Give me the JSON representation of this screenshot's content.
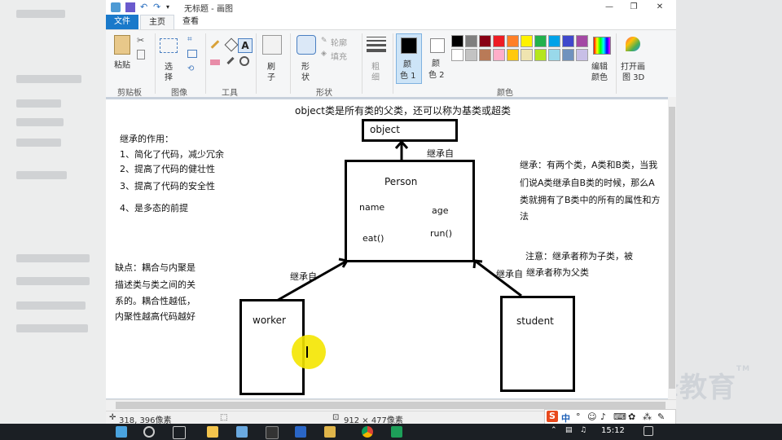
{
  "window": {
    "title": "无标题 - 画图",
    "minimize": "—",
    "restore": "❐",
    "close": "✕"
  },
  "tabs": {
    "file": "文件",
    "home": "主页",
    "view": "查看"
  },
  "ribbon": {
    "clipboard": {
      "paste": "粘贴",
      "label": "剪贴板"
    },
    "image": {
      "select": "选",
      "select2": "择",
      "label": "图像"
    },
    "tools": {
      "label": "工具"
    },
    "brushes": {
      "brush": "刷",
      "brush2": "子"
    },
    "shapes": {
      "shape": "形",
      "shape2": "状",
      "outline": "轮廓",
      "fill": "填充",
      "label": "形状"
    },
    "size": {
      "label": "粗",
      "label2": "细"
    },
    "colors": {
      "color1a": "颜",
      "color1b": "色 1",
      "color2a": "颜",
      "color2b": "色 2",
      "edit1": "编辑",
      "edit2": "颜色",
      "label": "颜色",
      "open3d_1": "打开画",
      "open3d_2": "图 3D"
    },
    "palette": [
      "#000000",
      "#7f7f7f",
      "#880015",
      "#ed1c24",
      "#ff7f27",
      "#fff200",
      "#22b14c",
      "#00a2e8",
      "#3f48cc",
      "#a349a4",
      "#ffffff",
      "#c3c3c3",
      "#b97a57",
      "#ffaec9",
      "#ffc90e",
      "#efe4b0",
      "#b5e61d",
      "#99d9ea",
      "#7092be",
      "#c8bfe7"
    ]
  },
  "canvas": {
    "header": "object类是所有类的父类，还可以称为基类或超类",
    "object_label": "object",
    "inherit_top": "继承自",
    "person": "Person",
    "name": "name",
    "age": "age",
    "eat": "eat()",
    "run": "run()",
    "purpose_title": "继承的作用：",
    "purpose1": "1、简化了代码，减少冗余",
    "purpose2": "2、提高了代码的健壮性",
    "purpose3": "3、提高了代码的安全性",
    "purpose4": "4、是多态的前提",
    "right_desc1": "继承：有两个类，A类和B类，当我",
    "right_desc2": "们说A类继承自B类的时候，那么A",
    "right_desc3": "类就拥有了B类中的所有的属性和方",
    "right_desc4": "法",
    "note1": "注意：继承者称为子类，被",
    "note2": "继承者称为父类",
    "inherit_left": "继承自",
    "inherit_right": "继承自",
    "shortcoming1": "缺点：耦合与内聚是",
    "shortcoming2": "描述类与类之间的关",
    "shortcoming3": "系的。耦合性越低，",
    "shortcoming4": "内聚性越高代码越好",
    "worker": "worker",
    "student": "student"
  },
  "status": {
    "coords": "318, 396像素",
    "size": "912 × 477像素"
  },
  "ime": {
    "brand": "S",
    "lang": "中"
  },
  "taskbar": {
    "clock": "15:12"
  },
  "watermark": {
    "text": "千锋教育",
    "tm": "TM"
  }
}
